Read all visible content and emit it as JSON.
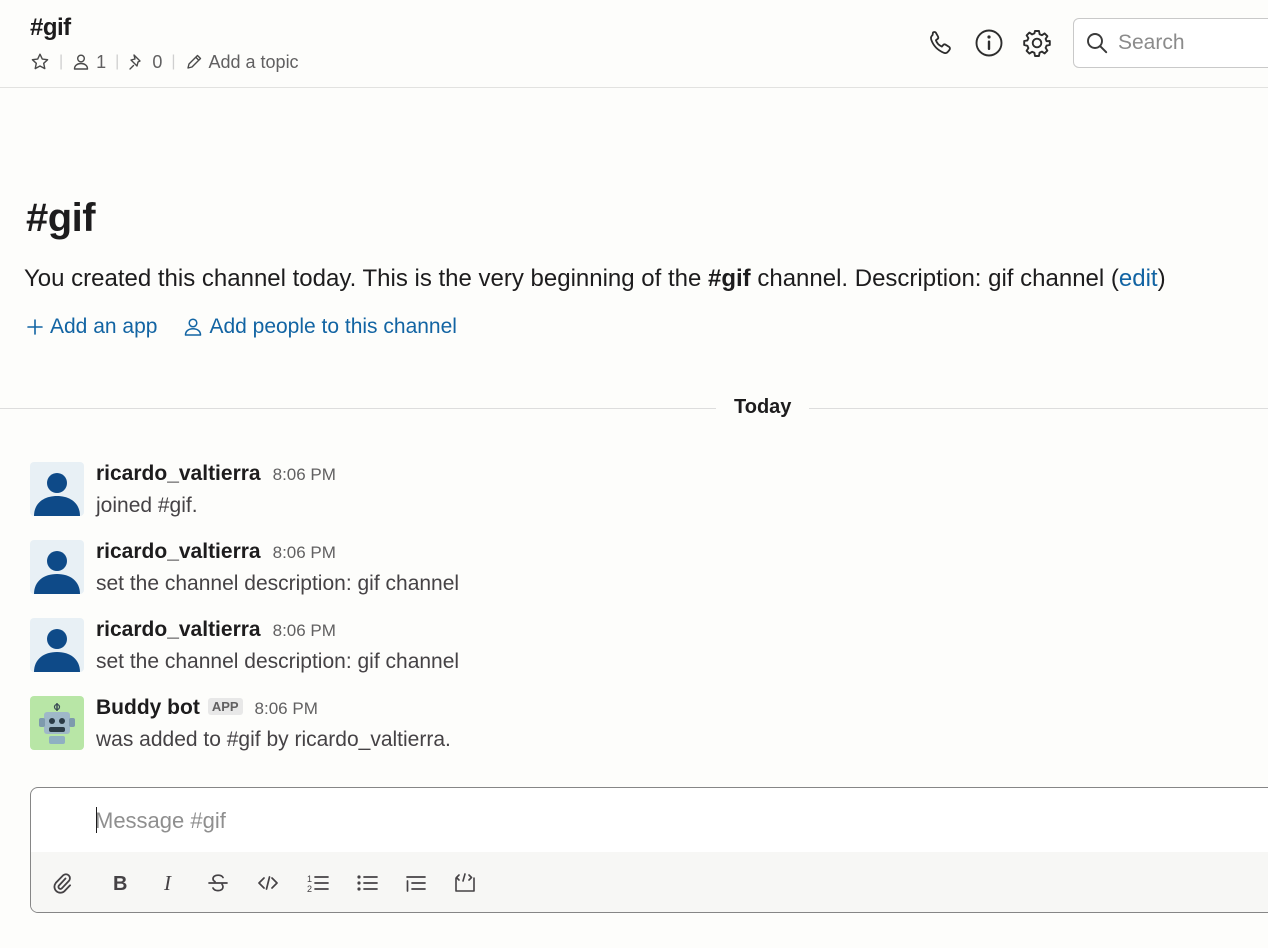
{
  "header": {
    "channel_name": "#gif",
    "member_count": "1",
    "pinned_count": "0",
    "add_topic_label": "Add a topic",
    "search_placeholder": "Search"
  },
  "intro": {
    "title": "#gif",
    "text_before": "You created this channel today. This is the very beginning of the ",
    "channel_bold": "#gif",
    "text_after": " channel. Description: gif channel (",
    "edit_link": "edit",
    "text_close": ")",
    "add_app_label": "Add an app",
    "add_people_label": "Add people to this channel"
  },
  "divider": {
    "label": "Today"
  },
  "messages": [
    {
      "user": "ricardo_valtierra",
      "time": "8:06 PM",
      "text": "joined #gif."
    },
    {
      "user": "ricardo_valtierra",
      "time": "8:06 PM",
      "text": "set the channel description: gif channel"
    },
    {
      "user": "ricardo_valtierra",
      "time": "8:06 PM",
      "text": "set the channel description: gif channel"
    },
    {
      "user": "Buddy bot",
      "badge": "APP",
      "time": "8:06 PM",
      "text": "was added to #gif by ricardo_valtierra."
    }
  ],
  "composer": {
    "placeholder": "Message #gif",
    "toolbar": [
      "paperclip-icon",
      "bold-icon",
      "italic-icon",
      "strikethrough-icon",
      "code-icon",
      "ordered-list-icon",
      "bulleted-list-icon",
      "blockquote-icon",
      "code-block-icon"
    ]
  },
  "colors": {
    "link": "#1264a3",
    "avatar_bg": "#e8f0f5",
    "avatar_fg": "#0e4a88",
    "bot_bg": "#b8e6a6"
  }
}
